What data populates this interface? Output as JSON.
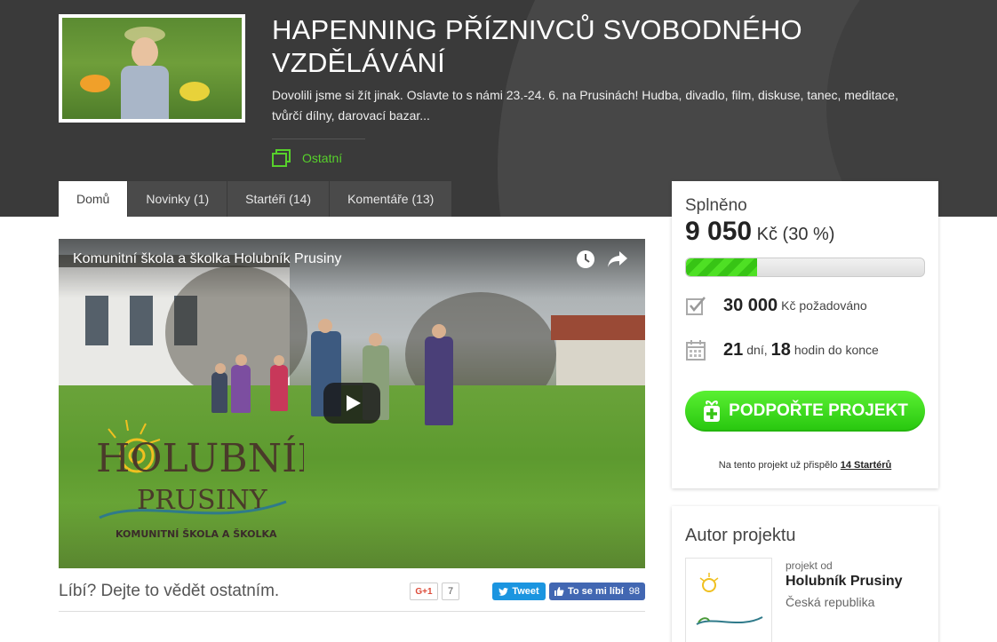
{
  "project": {
    "title": "HAPENNING PŘÍZNIVCŮ SVOBODNÉHO VZDĚLÁVÁNÍ",
    "description": "Dovolili jsme si žít jinak. Oslavte to s námi 23.-24. 6. na Prusinách! Hudba, divadlo, film, diskuse, tanec, meditace, tvůrčí dílny, darovací bazar...",
    "category": "Ostatní",
    "category_icon": "category-icon"
  },
  "tabs": [
    {
      "label": "Domů"
    },
    {
      "label": "Novinky (1)"
    },
    {
      "label": "Startéři (14)"
    },
    {
      "label": "Komentáře (13)"
    }
  ],
  "video": {
    "title": "Komunitní škola a školka Holubník Prusiny",
    "logo_line1": "HOLUBNÍK",
    "logo_line2": "PRUSINY",
    "logo_line3": "KOMUNITNÍ ŠKOLA A ŠKOLKA"
  },
  "social": {
    "like_prompt": "Líbí? Dejte to vědět ostatním.",
    "gplus_label": "G+1",
    "gplus_count": "7",
    "tweet_label": "Tweet",
    "fb_label": "To se mi líbí",
    "fb_count": "98"
  },
  "funding": {
    "label": "Splněno",
    "amount": "9 050",
    "currency": "Kč",
    "percent_text": "(30 %)",
    "progress_fraction": 0.3,
    "goal_amount": "30 000",
    "goal_suffix": "Kč požadováno",
    "days": "21",
    "days_label": "dní,",
    "hours": "18",
    "hours_label": "hodin do konce",
    "support_button": "PODPOŘTE PROJEKT",
    "starters_prefix": "Na tento projekt už přispělo",
    "starters_link": "14 Startérů",
    "accent_color": "#37c415"
  },
  "author": {
    "heading": "Autor projektu",
    "prefix": "projekt od",
    "name": "Holubník Prusiny",
    "country": "Česká republika"
  }
}
